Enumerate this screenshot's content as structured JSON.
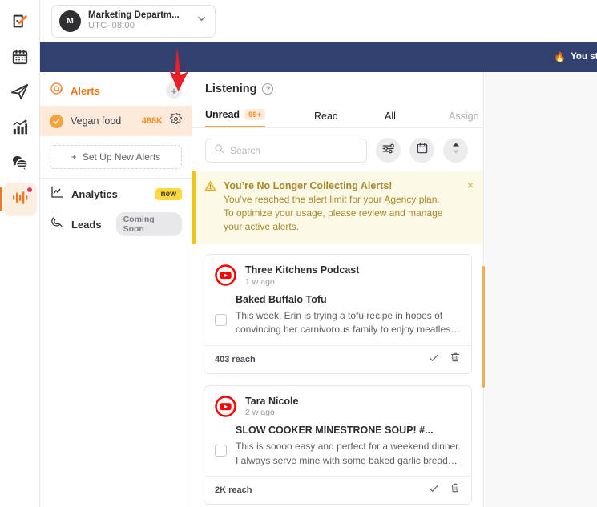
{
  "rail": {
    "items": [
      {
        "name": "tasks-icon",
        "label": "Tasks",
        "active": false
      },
      {
        "name": "calendar-icon",
        "label": "Calendar",
        "active": false
      },
      {
        "name": "publish-icon",
        "label": "Publish",
        "active": false
      },
      {
        "name": "analytics-icon",
        "label": "Analytics",
        "active": false
      },
      {
        "name": "inbox-icon",
        "label": "Inbox",
        "active": false
      },
      {
        "name": "listening-icon",
        "label": "Listening",
        "active": true
      }
    ]
  },
  "topbar": {
    "org_initial": "M",
    "org_name": "Marketing Departm...",
    "timezone": "UTC–08:00"
  },
  "banner": {
    "emoji": "🔥",
    "text": "You still hav"
  },
  "sidebar": {
    "alerts_label": "Alerts",
    "add_alert_label": "+",
    "alert_items": [
      {
        "label": "Vegan food",
        "count": "488K"
      }
    ],
    "setup_plus": "+",
    "setup_label": "Set Up New Alerts",
    "nav": [
      {
        "label": "Analytics",
        "badge": "new",
        "badge_type": "new"
      },
      {
        "label": "Leads",
        "badge": "Coming Soon",
        "badge_type": "soon"
      }
    ]
  },
  "panel": {
    "title": "Listening",
    "help": "?",
    "tabs": [
      {
        "label": "Unread",
        "badge": "99+",
        "active": true,
        "muted": false
      },
      {
        "label": "Read",
        "badge": "",
        "active": false,
        "muted": false
      },
      {
        "label": "All",
        "badge": "",
        "active": false,
        "muted": false
      },
      {
        "label": "Assign",
        "badge": "",
        "active": false,
        "muted": true
      }
    ],
    "search": {
      "value": "",
      "placeholder": "Search"
    },
    "toolbar_buttons": [
      {
        "name": "filter-icon",
        "label": "Filter"
      },
      {
        "name": "calendar-icon",
        "label": "Date range"
      },
      {
        "name": "sort-icon",
        "label": "Sort"
      }
    ]
  },
  "warning": {
    "title": "You’re No Longer Collecting Alerts!",
    "line1": "You’ve reached the alert limit for your Agency plan.",
    "line2": "To optimize your usage, please review and manage",
    "line3": "your active alerts.",
    "close": "×"
  },
  "feed": {
    "cards": [
      {
        "author": "Three Kitchens Podcast",
        "time": "1 w ago",
        "title": "Baked Buffalo Tofu",
        "snippet_line1": "This week, Erin is trying a tofu recipe in hopes of",
        "snippet_line2": "convincing her carnivorous family to enjoy meatles…",
        "reach": "403 reach"
      },
      {
        "author": "Tara Nicole",
        "time": "2 w ago",
        "title": "SLOW COOKER MINESTRONE SOUP! #...",
        "snippet_line1": "This is soooo easy and perfect for a weekend dinner.",
        "snippet_line2": "I always serve mine with some baked garlic bread…",
        "reach": "2K reach"
      }
    ]
  },
  "colors": {
    "accent_orange": "#f47820",
    "banner_navy": "#32406f",
    "alert_row_bg": "#fdeada",
    "warning_bg": "#fcfae6",
    "warning_border": "#f0c419",
    "warning_text": "#a8862a",
    "badge_yellow": "#ffd83d",
    "youtube_red": "#ff0000",
    "scrollbar": "#f6ab55",
    "annotation_red": "#e81f24"
  }
}
